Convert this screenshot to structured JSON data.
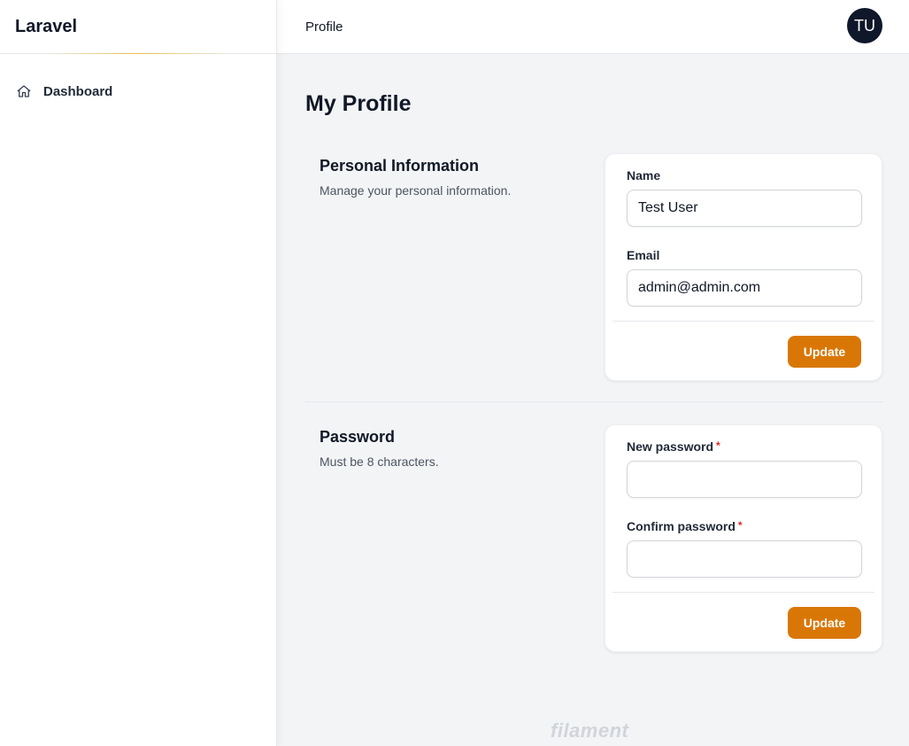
{
  "app": {
    "name": "Laravel"
  },
  "sidebar": {
    "items": [
      {
        "label": "Dashboard",
        "icon": "home-icon"
      }
    ]
  },
  "topbar": {
    "breadcrumb": "Profile",
    "avatar_initials": "TU"
  },
  "page": {
    "title": "My Profile"
  },
  "personal_info": {
    "heading": "Personal Information",
    "description": "Manage your personal information.",
    "name_label": "Name",
    "name_value": "Test User",
    "email_label": "Email",
    "email_value": "admin@admin.com",
    "update_label": "Update"
  },
  "password": {
    "heading": "Password",
    "description": "Must be 8 characters.",
    "new_label": "New password",
    "confirm_label": "Confirm password",
    "required_mark": "*",
    "new_value": "",
    "confirm_value": "",
    "update_label": "Update"
  },
  "footer": {
    "brand": "filament"
  },
  "colors": {
    "accent": "#d97706",
    "required": "#dc2626",
    "avatar_bg": "#0f172a"
  }
}
